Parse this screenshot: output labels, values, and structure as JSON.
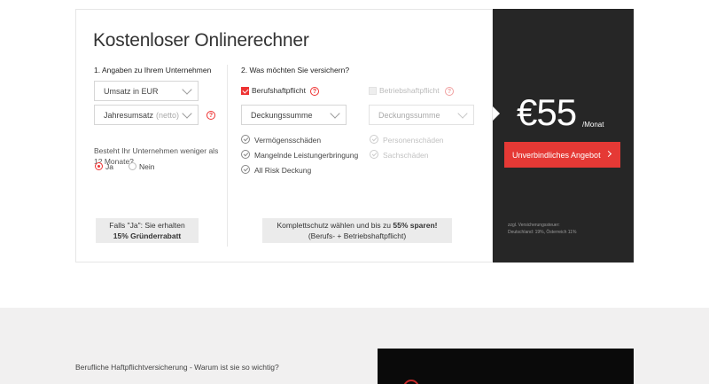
{
  "calculator": {
    "title": "Kostenloser Onlinerechner",
    "section1": {
      "heading": "1. Angaben zu Ihrem Unternehmen",
      "currency_select": "Umsatz in EUR",
      "revenue_select": "Jahresumsatz",
      "revenue_hint": "(netto)",
      "question": "Besteht Ihr Unternehmen weniger als 12 Monate?",
      "radio_yes": "Ja",
      "radio_no": "Nein",
      "radio_selected": "Ja",
      "info_line1": "Falls \"Ja\": Sie erhalten",
      "info_line2": "15% Gründerrabatt"
    },
    "section2": {
      "heading": "2. Was möchten Sie versichern?",
      "option1_label": "Berufshaftpflicht",
      "option1_checked": true,
      "option2_label": "Betriebshaftpflicht",
      "option2_checked": false,
      "select1": "Deckungssumme",
      "select2": "Deckungssumme",
      "features1": [
        "Vermögensschäden",
        "Mangelnde Leistungerbringung",
        "All Risk Deckung"
      ],
      "features2": [
        "Personenschäden",
        "Sachschäden"
      ],
      "info_line1_pre": "Komplettschutz wählen und bis zu ",
      "info_line1_bold": "55% sparen!",
      "info_line2": "(Berufs- + Betriebshaftpflicht)"
    },
    "help_icon": "?"
  },
  "price": {
    "value": "€55",
    "unit": "/Monat",
    "cta": "Unverbindliches Angebot",
    "tax_line1": "zzgl. Versicherungssteuer:",
    "tax_line2": "Deutschland: 19%, Österreich 11%"
  },
  "below": {
    "section_title": "Berufliche Haftpflichtversicherung - Warum ist sie so wichtig?"
  },
  "colors": {
    "accent": "#e53935",
    "panel": "#262626",
    "info_box": "#ebebeb"
  }
}
